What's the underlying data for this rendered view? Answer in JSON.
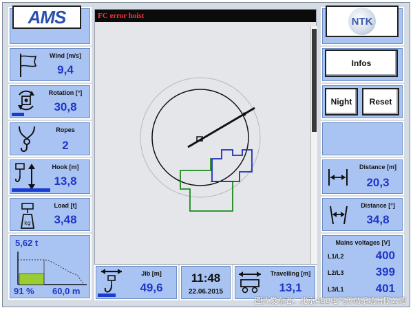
{
  "header": {
    "logo_left": "AMS",
    "logo_right": "NTK",
    "error": "FC error hoist"
  },
  "left": {
    "wind": {
      "label": "Wind [m/s]",
      "value": "9,4"
    },
    "rotation": {
      "label": "Rotation [°]",
      "value": "30,8",
      "bar_fraction": 0.33
    },
    "ropes": {
      "label": "Ropes",
      "value": "2"
    },
    "hook": {
      "label": "Hook [m]",
      "value": "13,8",
      "bar_fraction": 0.48
    },
    "load": {
      "label": "Load [t]",
      "value": "3,48"
    },
    "capacity": {
      "load": "5,62 t",
      "percent": "91 %",
      "radius": "60,0 m"
    }
  },
  "right": {
    "infos_label": "Infos",
    "night_label": "Night",
    "reset_label": "Reset",
    "distance_m": {
      "label": "Distance [m]",
      "value": "20,3"
    },
    "distance_deg": {
      "label": "Distance [°]",
      "value": "34,8"
    },
    "mains": {
      "label": "Mains voltages [V]",
      "rows": [
        {
          "phase": "L1/L2",
          "value": "400"
        },
        {
          "phase": "L2/L3",
          "value": "399"
        },
        {
          "phase": "L3/L1",
          "value": "401"
        }
      ]
    }
  },
  "bottom": {
    "jib": {
      "label": "Jib [m]",
      "value": "49,6",
      "bar_fraction": 0.22
    },
    "clock": {
      "time": "11:48",
      "date": "22.06.2015"
    },
    "travelling": {
      "label": "Travelling [m]",
      "value": "13,1"
    }
  },
  "watermark": "图片发布者：北京ABB电气传动系统有限公司",
  "colors": {
    "panel": "#a9c4f2",
    "value_text": "#1f35c8",
    "error_text": "#ff3333",
    "zone_blue": "#1f2fb5",
    "zone_green": "#1a8a1a"
  }
}
